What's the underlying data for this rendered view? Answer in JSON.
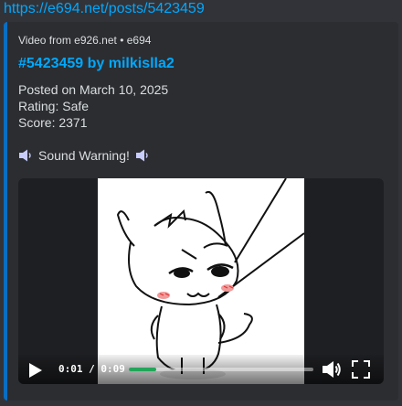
{
  "message": {
    "link_text": "https://e694.net/posts/5423459"
  },
  "embed": {
    "accent_color": "#0a6ec2",
    "provider": "Video from e926.net • e694",
    "title": "#5423459 by milkislla2",
    "description": {
      "posted": "Posted on March 10, 2025",
      "rating": "Rating: Safe",
      "score": "Score: 2371"
    },
    "warning": "Sound Warning!",
    "warning_icon": "speaker-icon"
  },
  "video": {
    "current_time": "0:01",
    "separator": "/",
    "duration": "0:09",
    "time_display": "0:01 / 0:09",
    "progress_fraction": 0.15,
    "progress_color": "#23a55a",
    "play_icon": "play-icon",
    "volume_icon": "volume-icon",
    "fullscreen_icon": "fullscreen-icon"
  }
}
